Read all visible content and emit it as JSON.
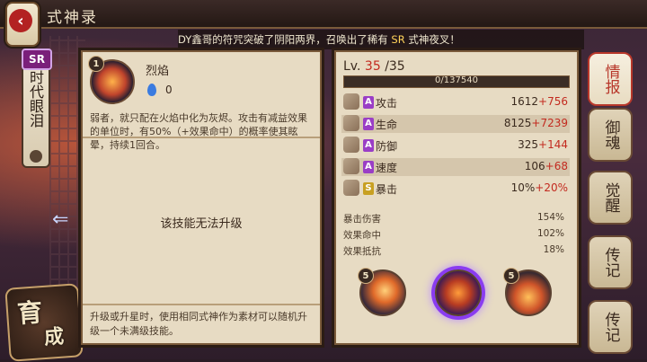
{
  "header": {
    "title": "式神录",
    "back_icon": "chevron-left-icon"
  },
  "marquee": {
    "prefix": "DY鑫哥的符咒突破了阴阳两界，召唤出了稀有",
    "rarity": "SR",
    "suffix": "式神夜叉！"
  },
  "shikigami": {
    "rarity": "SR",
    "name": "时代眼泪"
  },
  "nurture": {
    "line1": "育",
    "line2": "成"
  },
  "skill": {
    "level": "1",
    "name": "烈焰",
    "orb_cost": "0",
    "description": "弱者，就只配在火焰中化为灰烬。攻击有减益效果的单位时，有50%（+效果命中）的概率使其眩晕，持续1回合。",
    "no_upgrade": "该技能无法升级",
    "upgrade_tip": "升级或升星时，使用相同式神作为素材可以随机升级一个未满级技能。"
  },
  "stats": {
    "level_label": "Lv.",
    "level_current": "35",
    "level_max": "/35",
    "xp_text": "0/137540",
    "xp_fraction": 0.0,
    "rows": [
      {
        "label": "攻击",
        "base": "1612",
        "bonus": "+756",
        "grade": "A"
      },
      {
        "label": "生命",
        "base": "8125",
        "bonus": "+7239",
        "grade": "A"
      },
      {
        "label": "防御",
        "base": "325",
        "bonus": "+144",
        "grade": "A"
      },
      {
        "label": "速度",
        "base": "106",
        "bonus": "+68",
        "grade": "A"
      },
      {
        "label": "暴击",
        "base": "10%",
        "bonus": "+20%",
        "grade": "S"
      }
    ],
    "extra": [
      {
        "label": "暴击伤害",
        "value": "154%"
      },
      {
        "label": "效果命中",
        "value": "102%"
      },
      {
        "label": "效果抵抗",
        "value": "18%"
      }
    ],
    "skill_levels": [
      "5",
      "5"
    ]
  },
  "tabs": [
    {
      "label": "情报",
      "active": true
    },
    {
      "label": "御魂",
      "active": false
    },
    {
      "label": "觉醒",
      "active": false
    },
    {
      "label": "传记",
      "active": false
    },
    {
      "label": "传记",
      "active": false
    }
  ]
}
